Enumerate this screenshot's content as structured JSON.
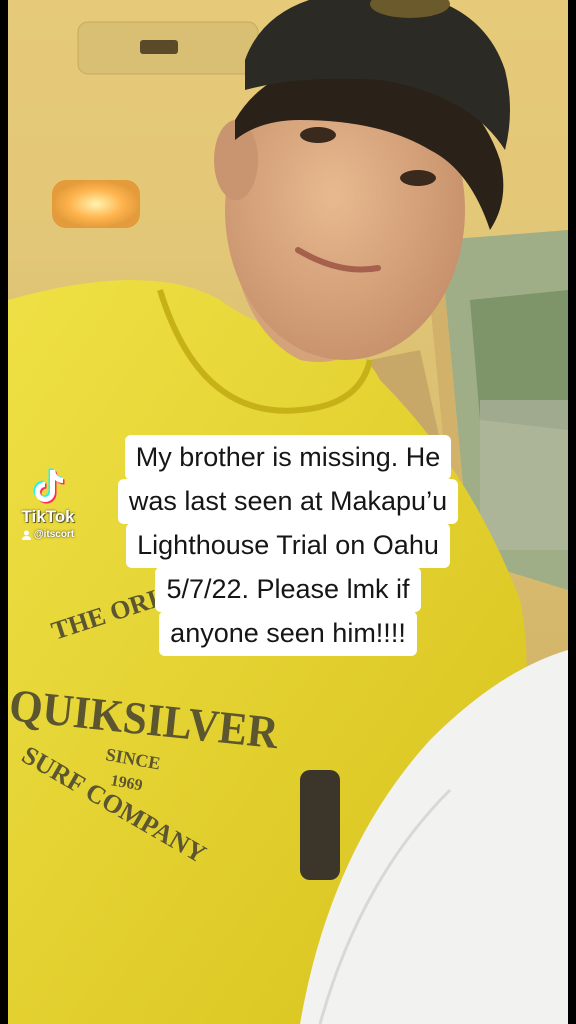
{
  "watermark": {
    "brand": "TikTok",
    "username": "@itscort",
    "logo_icon": "tiktok-note-icon",
    "user_icon": "person-icon"
  },
  "caption": {
    "lines": [
      "My brother is missing. He",
      "was last seen at Makapu’u",
      "Lighthouse Trial on Oahu",
      "5/7/22. Please lmk if",
      "anyone seen him!!!!"
    ]
  },
  "shirt_print": {
    "top_arc": "THE ORIGINAL",
    "brand": "QUIKSILVER",
    "bottom_arc": "SURF COMPANY",
    "since": "SINCE",
    "year": "1969"
  },
  "colors": {
    "shirt": "#e6d22a",
    "caption_bg": "#ffffff",
    "caption_text": "#161616"
  }
}
